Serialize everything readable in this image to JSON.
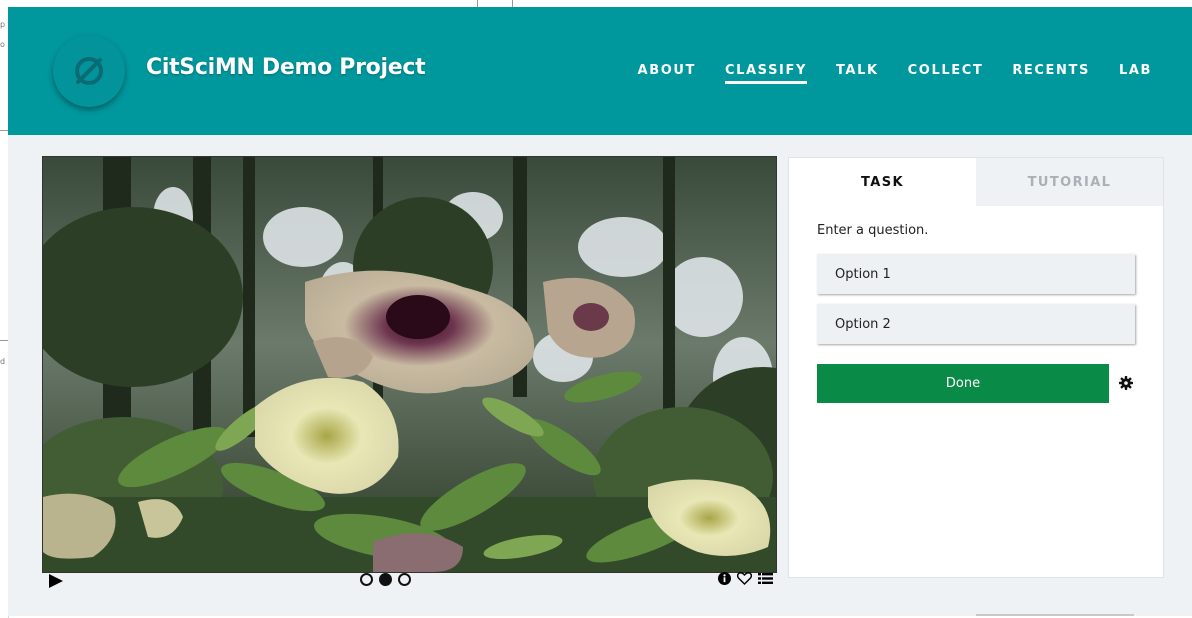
{
  "header": {
    "project_title": "CitSciMN Demo Project",
    "bg_color": "#00979d",
    "nav": [
      {
        "label": "ABOUT",
        "active": false
      },
      {
        "label": "CLASSIFY",
        "active": true
      },
      {
        "label": "TALK",
        "active": false
      },
      {
        "label": "COLLECT",
        "active": false
      },
      {
        "label": "RECENTS",
        "active": false
      },
      {
        "label": "LAB",
        "active": false
      }
    ]
  },
  "subject": {
    "image_icon": "flowers-photo",
    "frames": 3,
    "active_frame": 2,
    "controls": [
      "play-icon",
      "info-icon",
      "heart-icon",
      "list-icon"
    ]
  },
  "task_panel": {
    "tabs": [
      {
        "label": "TASK",
        "active": true
      },
      {
        "label": "TUTORIAL",
        "active": false
      }
    ],
    "question": "Enter a question.",
    "options": [
      "Option 1",
      "Option 2"
    ],
    "done_label": "Done",
    "done_color": "#0a8a47"
  },
  "gutter_text": [
    "p",
    "o",
    "d"
  ]
}
